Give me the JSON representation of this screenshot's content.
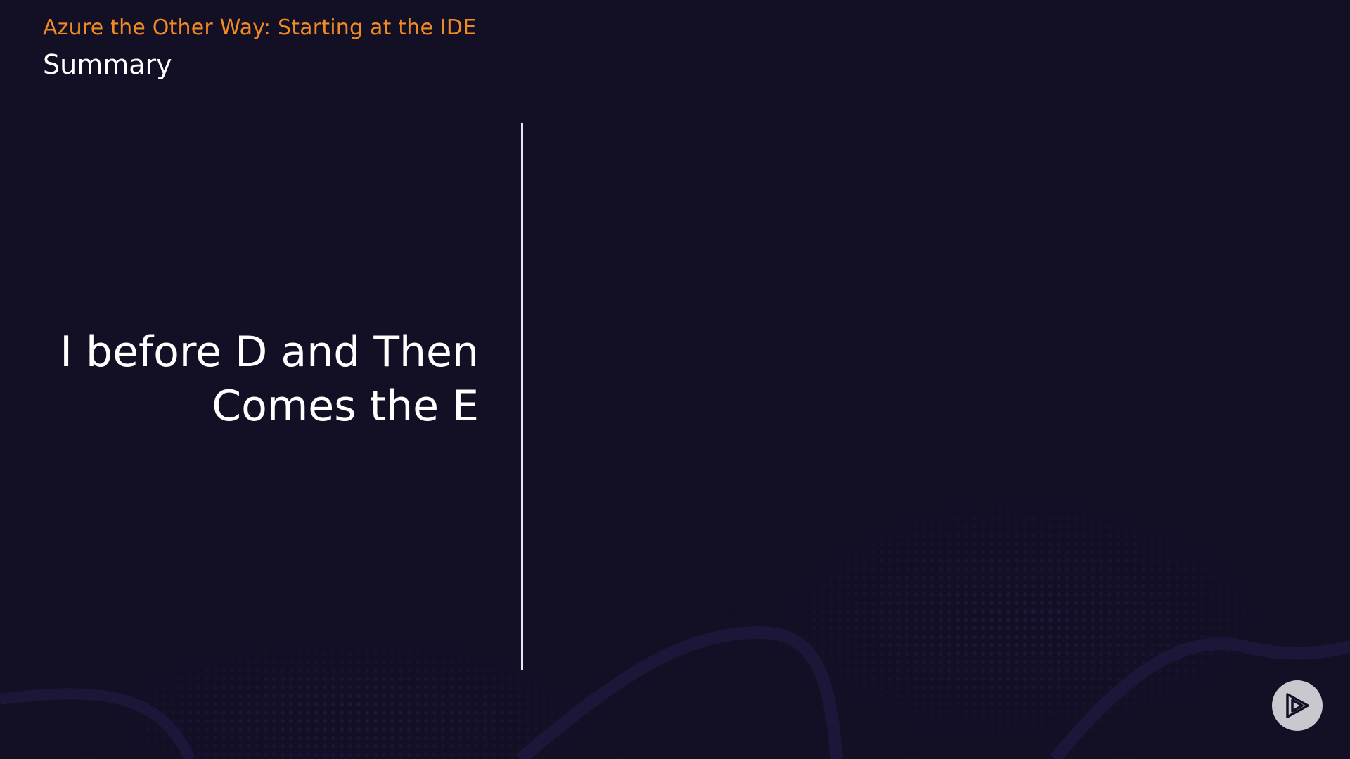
{
  "header": {
    "course_title": "Azure the Other Way: Starting at the IDE",
    "module_title": "Summary"
  },
  "main": {
    "headline_line1": "I before D and Then",
    "headline_line2": "Comes the E"
  },
  "logo": {
    "icon": "play-logo-icon"
  },
  "colors": {
    "background": "#130f24",
    "accent": "#f08a24",
    "text": "#ffffff",
    "divider": "#e8e6f0",
    "logo_circle": "#c9c8ce"
  }
}
